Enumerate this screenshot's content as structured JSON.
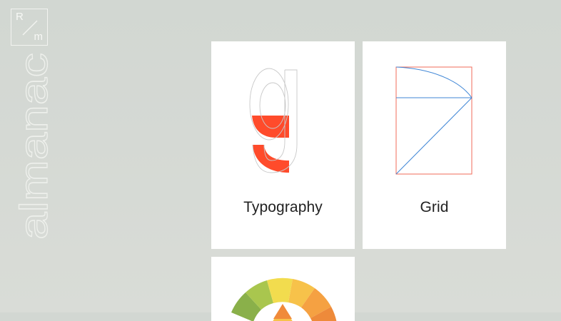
{
  "logo": {
    "letter_top": "R",
    "letter_bottom": "m"
  },
  "wordmark": "almanac",
  "cards": [
    {
      "label": "Typography"
    },
    {
      "label": "Grid"
    },
    {
      "label": ""
    }
  ],
  "colors": {
    "accent_red": "#ff4b2b",
    "grid_blue": "#3f86d6",
    "grid_red": "#f26b5a"
  }
}
